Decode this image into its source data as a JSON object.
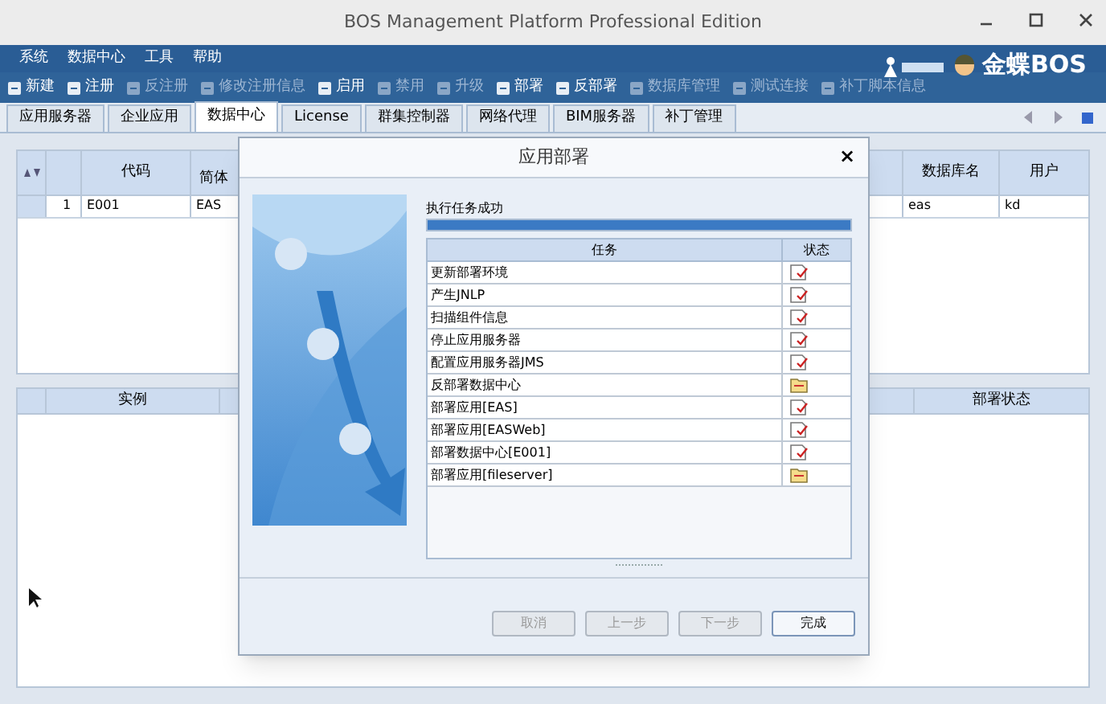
{
  "window": {
    "title": "BOS Management Platform Professional Edition"
  },
  "menu": [
    "系统",
    "数据中心",
    "工具",
    "帮助"
  ],
  "brand": "金蝶BOS",
  "toolbar": [
    {
      "label": "新建",
      "disabled": false
    },
    {
      "label": "注册",
      "disabled": false
    },
    {
      "label": "反注册",
      "disabled": true
    },
    {
      "label": "修改注册信息",
      "disabled": true
    },
    {
      "label": "启用",
      "disabled": false
    },
    {
      "label": "禁用",
      "disabled": true
    },
    {
      "label": "升级",
      "disabled": true
    },
    {
      "label": "部署",
      "disabled": false
    },
    {
      "label": "反部署",
      "disabled": false
    },
    {
      "label": "数据库管理",
      "disabled": true
    },
    {
      "label": "测试连接",
      "disabled": true
    },
    {
      "label": "补丁脚本信息",
      "disabled": true
    }
  ],
  "tabs": [
    {
      "label": "应用服务器",
      "selected": false
    },
    {
      "label": "企业应用",
      "selected": false
    },
    {
      "label": "数据中心",
      "selected": true
    },
    {
      "label": "License",
      "selected": false
    },
    {
      "label": "群集控制器",
      "selected": false
    },
    {
      "label": "网络代理",
      "selected": false
    },
    {
      "label": "BIM服务器",
      "selected": false
    },
    {
      "label": "补丁管理",
      "selected": false
    }
  ],
  "upper_table": {
    "columns": [
      "代码",
      "简体",
      "数据库名",
      "用户"
    ],
    "rows": [
      {
        "index": "1",
        "cells": [
          "E001",
          "EAS",
          "eas",
          "kd"
        ]
      }
    ]
  },
  "lower_table": {
    "columns": [
      "实例",
      "部署状态"
    ]
  },
  "dialog": {
    "title": "应用部署",
    "close": "×",
    "status_text": "执行任务成功",
    "progress": {
      "level": 1
    },
    "columns": [
      "任务",
      "状态"
    ],
    "tasks": [
      {
        "name": "更新部署环境",
        "kind": "doc"
      },
      {
        "name": "产生JNLP",
        "kind": "doc"
      },
      {
        "name": "扫描组件信息",
        "kind": "doc"
      },
      {
        "name": "停止应用服务器",
        "kind": "doc"
      },
      {
        "name": "配置应用服务器JMS",
        "kind": "doc"
      },
      {
        "name": "反部署数据中心",
        "kind": "folder"
      },
      {
        "name": "部署应用[EAS]",
        "kind": "doc"
      },
      {
        "name": "部署应用[EASWeb]",
        "kind": "doc"
      },
      {
        "name": "部署数据中心[E001]",
        "kind": "doc"
      },
      {
        "name": "部署应用[fileserver]",
        "kind": "folder"
      }
    ],
    "buttons": [
      {
        "label": "取消",
        "disabled": true
      },
      {
        "label": "上一步",
        "disabled": true
      },
      {
        "label": "下一步",
        "disabled": true
      },
      {
        "label": "完成",
        "disabled": false
      }
    ]
  }
}
